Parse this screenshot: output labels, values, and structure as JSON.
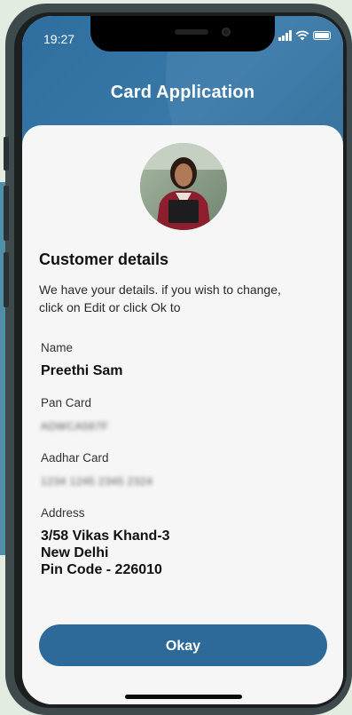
{
  "status_bar": {
    "time": "19:27"
  },
  "header": {
    "title": "Card Application"
  },
  "customer": {
    "section_title": "Customer details",
    "description": "We have your details. if you wish to change, click on Edit or click Ok to",
    "fields": [
      {
        "label": "Name",
        "value": "Preethi Sam"
      },
      {
        "label": "Pan Card",
        "value": "ADWCA567F"
      },
      {
        "label": "Aadhar Card",
        "value": "1234 1245 2345 2324"
      },
      {
        "label": "Address",
        "lines": [
          "3/58 Vikas Khand-3",
          "New Delhi",
          "Pin Code - 226010"
        ]
      }
    ]
  },
  "actions": {
    "okay_label": "Okay"
  },
  "colors": {
    "primary": "#2d6a99",
    "header": "#3878a8",
    "card": "#f6f6f6"
  },
  "icons": [
    "signal-icon",
    "wifi-icon",
    "battery-icon",
    "avatar"
  ]
}
